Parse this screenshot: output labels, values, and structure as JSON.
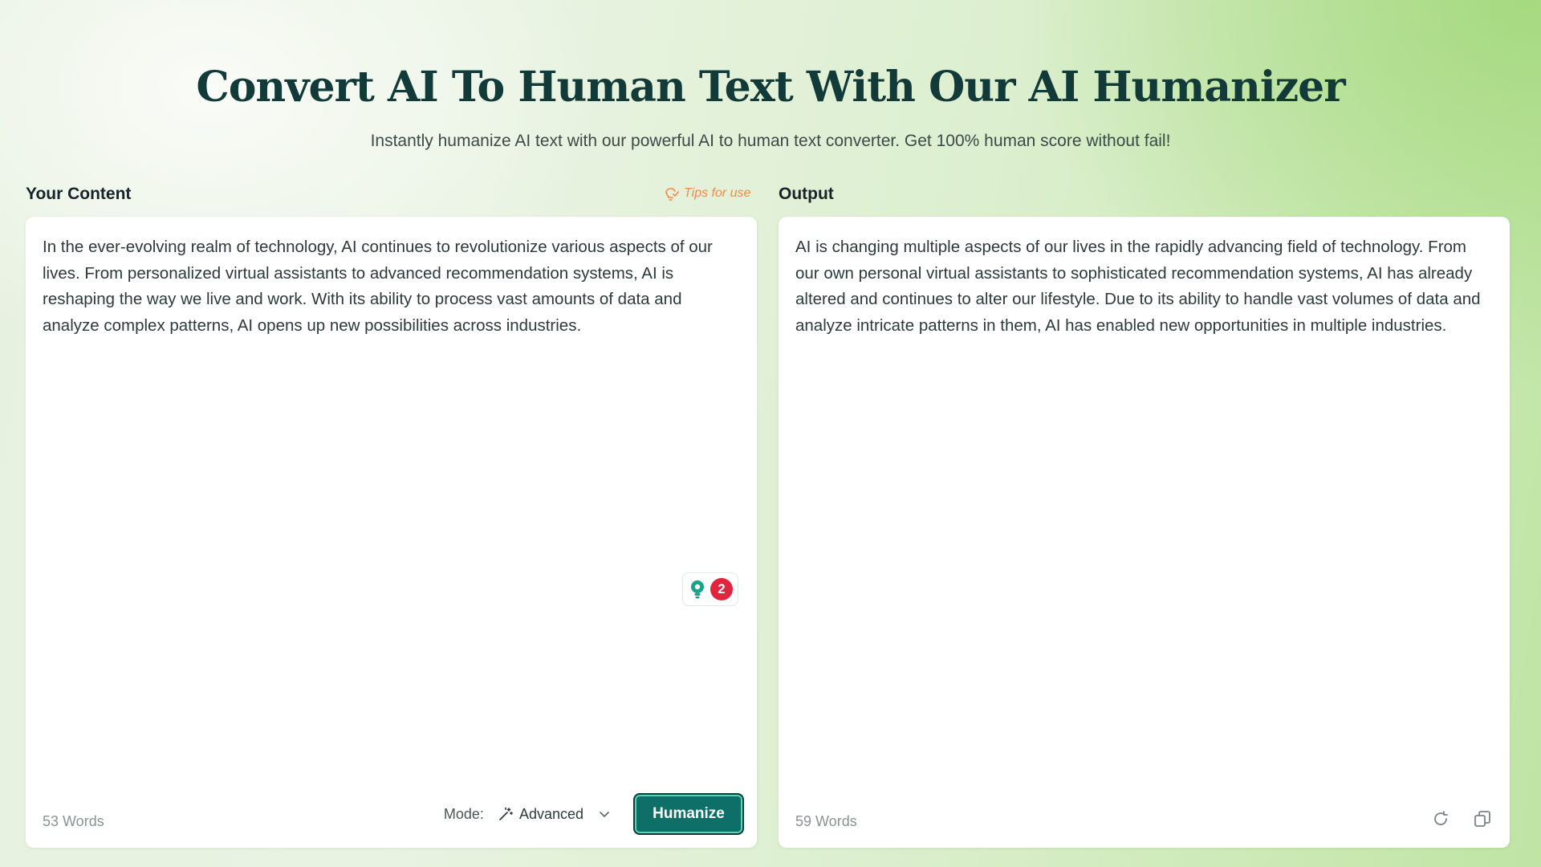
{
  "header": {
    "title": "Convert AI To Human Text With Our AI Humanizer",
    "subtitle": "Instantly humanize AI text with our powerful AI to human text converter. Get 100% human score without fail!"
  },
  "input_panel": {
    "label": "Your Content",
    "tips_label": "Tips for use",
    "text": "In the ever-evolving realm of technology, AI continues to revolutionize various aspects of our lives. From personalized virtual assistants to advanced recommendation systems, AI is reshaping the way we live and work. With its ability to process vast amounts of data and analyze complex patterns, AI opens up new possibilities across industries.",
    "word_count": "53 Words",
    "suggestion_count": "2",
    "mode_label": "Mode:",
    "mode_value": "Advanced",
    "humanize_label": "Humanize"
  },
  "output_panel": {
    "label": "Output",
    "text": "AI is changing multiple aspects of our lives in the rapidly advancing field of technology. From our own personal virtual assistants to sophisticated recommendation systems, AI has already altered and continues to alter our lifestyle. Due to its ability to handle vast volumes of data and analyze intricate patterns in them, AI has enabled new opportunities in multiple industries.",
    "word_count": "59 Words"
  },
  "colors": {
    "accent": "#0e6f68",
    "tips": "#f08a4b",
    "badge": "#e2243d",
    "title": "#123a38"
  },
  "icons": {
    "tips": "lightbulb-icon",
    "suggestion": "bulb-icon",
    "mode": "magic-wand-icon",
    "dropdown": "chevron-down-icon",
    "regenerate": "refresh-icon",
    "copy": "copy-icon"
  }
}
